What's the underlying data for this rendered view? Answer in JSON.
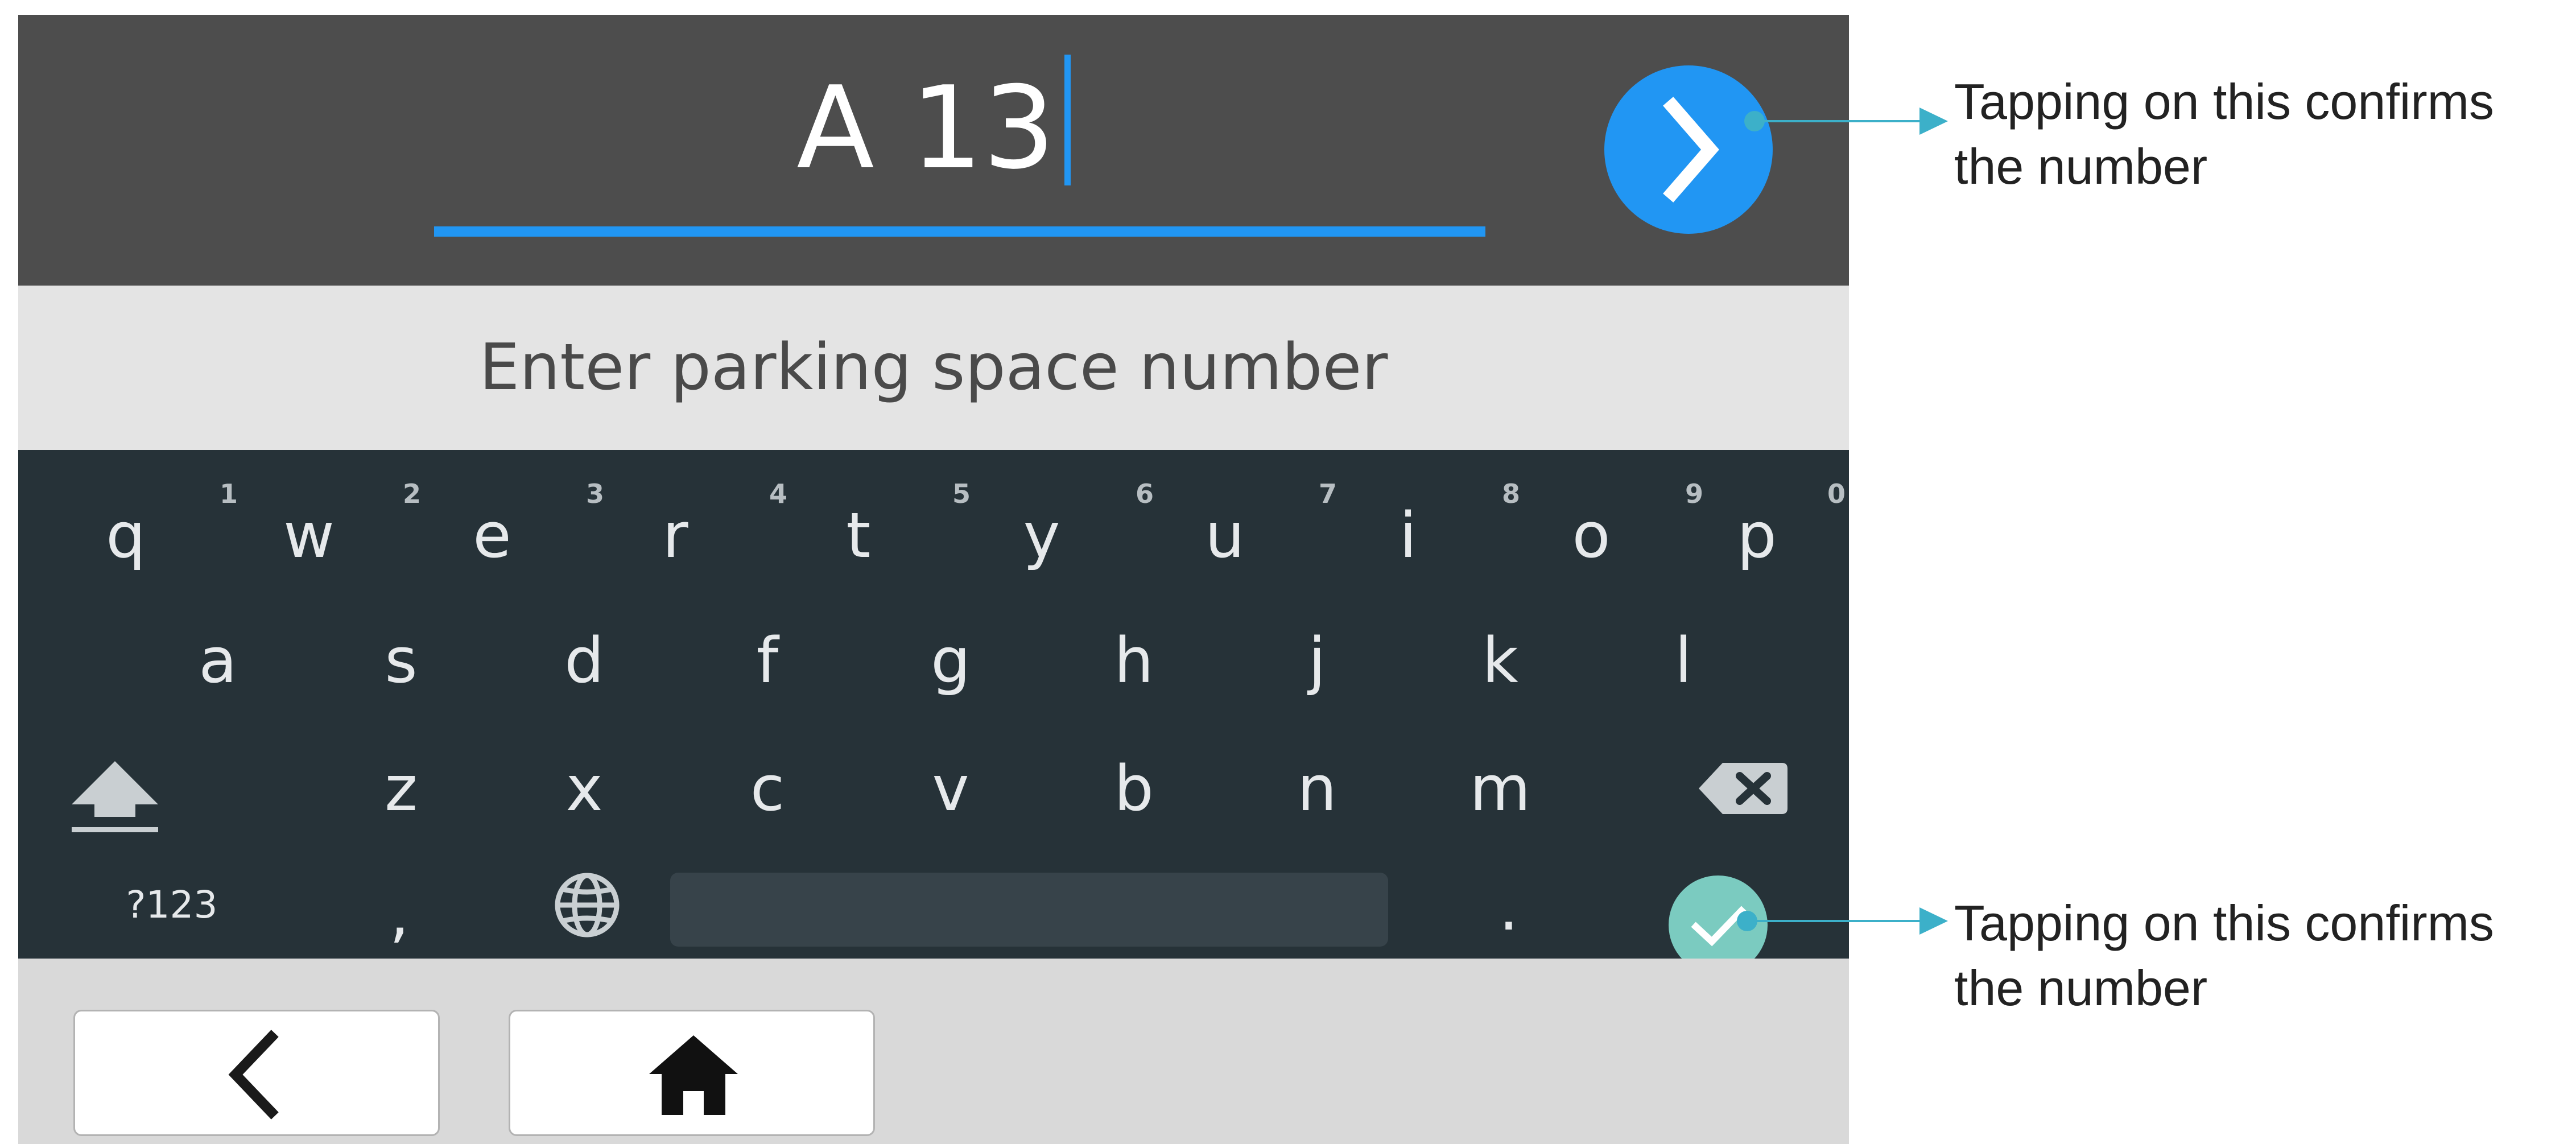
{
  "entry": {
    "value": "A 13",
    "underline_color": "#2196f3",
    "next_button_color": "#2196f3"
  },
  "prompt": {
    "text": "Enter parking space number"
  },
  "keyboard": {
    "row1": [
      {
        "key": "q",
        "hint": "1"
      },
      {
        "key": "w",
        "hint": "2"
      },
      {
        "key": "e",
        "hint": "3"
      },
      {
        "key": "r",
        "hint": "4"
      },
      {
        "key": "t",
        "hint": "5"
      },
      {
        "key": "y",
        "hint": "6"
      },
      {
        "key": "u",
        "hint": "7"
      },
      {
        "key": "i",
        "hint": "8"
      },
      {
        "key": "o",
        "hint": "9"
      },
      {
        "key": "p",
        "hint": "0"
      }
    ],
    "row2": [
      "a",
      "s",
      "d",
      "f",
      "g",
      "h",
      "j",
      "k",
      "l"
    ],
    "row3": [
      "z",
      "x",
      "c",
      "v",
      "b",
      "n",
      "m"
    ],
    "row4": {
      "symbols": "?123",
      "comma": ",",
      "period": "."
    },
    "icons": {
      "shift": "shift-icon",
      "backspace": "backspace-icon",
      "language": "globe-icon",
      "done": "checkmark-icon"
    },
    "done_color": "#7bcbc0",
    "background": "#263238"
  },
  "navbar": {
    "back_icon": "chevron-left-icon",
    "home_icon": "home-icon"
  },
  "callouts": [
    {
      "text": "Tapping on this confirms the number",
      "target": "next-button"
    },
    {
      "text": "Tapping on this confirms the number",
      "target": "keyboard-done-key"
    }
  ],
  "callout_color": "#3cb0c9"
}
